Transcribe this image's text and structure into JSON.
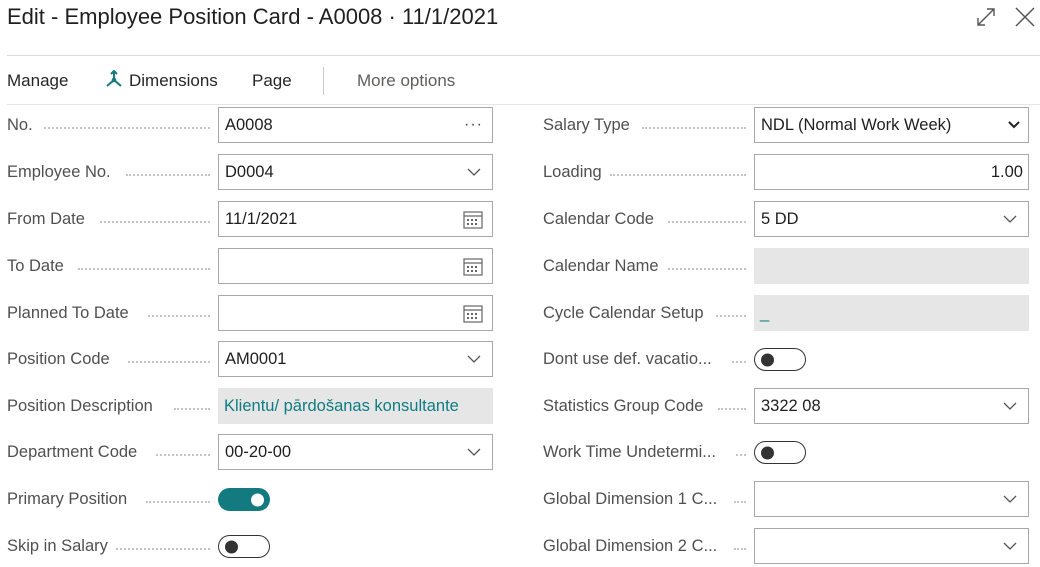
{
  "window": {
    "title": "Edit - Employee Position Card - A0008 · 11/1/2021",
    "expand_icon": "expand-icon",
    "close_icon": "close-icon"
  },
  "actions": {
    "manage": "Manage",
    "dimensions": "Dimensions",
    "page": "Page",
    "more_options": "More options"
  },
  "colors": {
    "accent": "#137b80",
    "readonly_bg": "#e6e6e6",
    "link_text": "#0e7d82"
  },
  "left": {
    "no": {
      "label": "No.",
      "value": "A0008"
    },
    "employee_no": {
      "label": "Employee No.",
      "value": "D0004"
    },
    "from_date": {
      "label": "From Date",
      "value": "11/1/2021"
    },
    "to_date": {
      "label": "To Date",
      "value": ""
    },
    "planned_to_date": {
      "label": "Planned To Date",
      "value": ""
    },
    "position_code": {
      "label": "Position Code",
      "value": "AM0001"
    },
    "position_description": {
      "label": "Position Description",
      "value": "Klientu/ pārdošanas konsultante"
    },
    "department_code": {
      "label": "Department Code",
      "value": "00-20-00"
    },
    "primary_position": {
      "label": "Primary Position",
      "value": "on"
    },
    "skip_in_salary": {
      "label": "Skip in Salary",
      "value": "off"
    }
  },
  "right": {
    "salary_type": {
      "label": "Salary Type",
      "value": "NDL (Normal Work Week)"
    },
    "loading": {
      "label": "Loading",
      "value": "1.00"
    },
    "calendar_code": {
      "label": "Calendar Code",
      "value": "5 DD"
    },
    "calendar_name": {
      "label": "Calendar Name",
      "value": ""
    },
    "cycle_calendar_setup": {
      "label": "Cycle Calendar Setup",
      "value": "_"
    },
    "dont_use_def_vacation": {
      "label": "Dont use def. vacatio...",
      "value": "off"
    },
    "statistics_group_code": {
      "label": "Statistics Group Code",
      "value": "3322 08"
    },
    "work_time_undetermined": {
      "label": "Work Time Undetermi...",
      "value": "off"
    },
    "global_dimension_1": {
      "label": "Global Dimension 1 C...",
      "value": ""
    },
    "global_dimension_2": {
      "label": "Global Dimension 2 C...",
      "value": ""
    }
  }
}
